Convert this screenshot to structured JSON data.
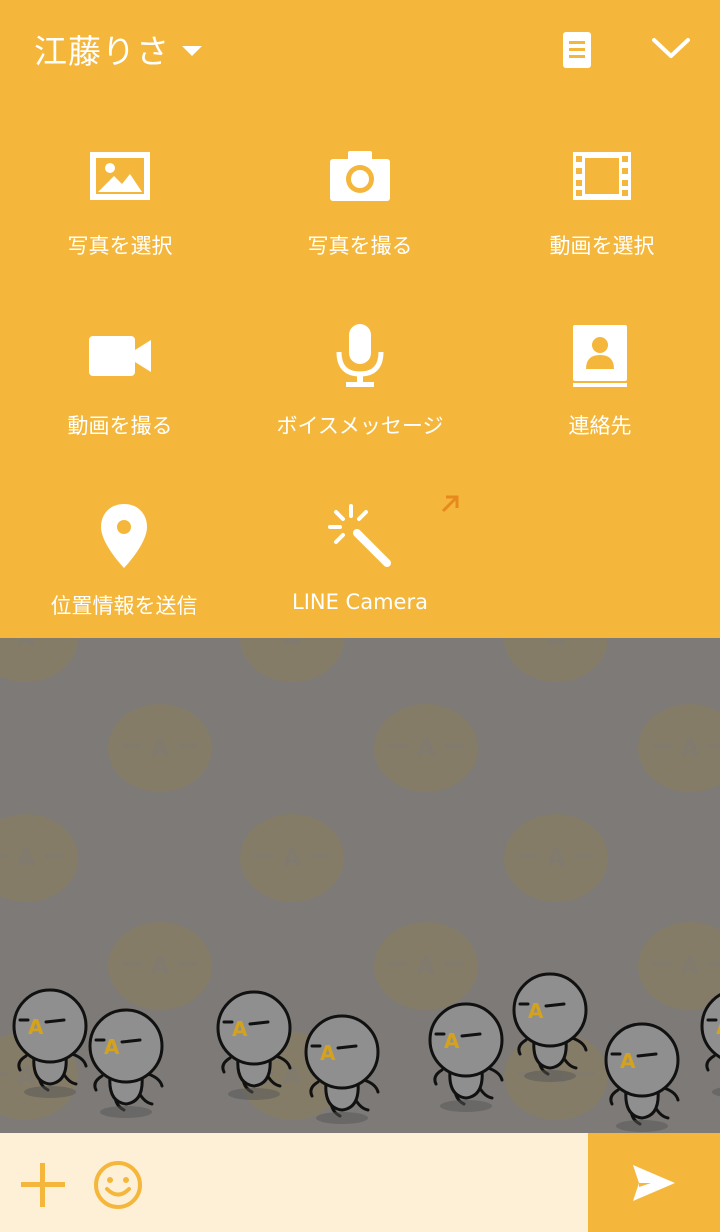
{
  "header": {
    "title": "江藤りさ",
    "caret_icon": "caret-down-icon",
    "note_icon": "note-icon",
    "close_icon": "chevron-down-icon"
  },
  "menu": {
    "items": [
      {
        "label": "写真を選択",
        "icon": "photo-icon"
      },
      {
        "label": "写真を撮る",
        "icon": "camera-icon"
      },
      {
        "label": "動画を選択",
        "icon": "film-icon"
      },
      {
        "label": "動画を撮る",
        "icon": "video-camera-icon"
      },
      {
        "label": "ボイスメッセージ",
        "icon": "microphone-icon"
      },
      {
        "label": "連絡先",
        "icon": "contact-book-icon"
      },
      {
        "label": "位置情報を送信",
        "icon": "location-pin-icon"
      },
      {
        "label": "LINE Camera",
        "icon": "magic-wand-icon",
        "badge_icon": "external-arrow-icon"
      }
    ]
  },
  "input_bar": {
    "plus_icon": "plus-icon",
    "emoji_icon": "smiley-icon",
    "send_icon": "send-arrow-icon"
  },
  "colors": {
    "accent": "#f4b73c",
    "panel_text": "#ffffff",
    "chat_background": "#7d7a77",
    "input_background": "#fef0d6"
  }
}
